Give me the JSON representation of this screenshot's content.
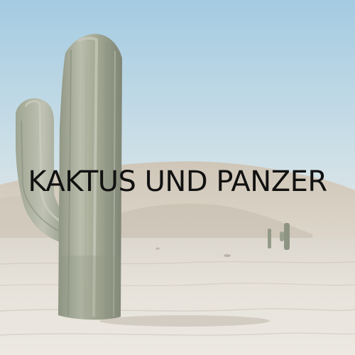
{
  "title": "KAKTUS UND PANZER",
  "colors": {
    "sky_top": "#a9cde3",
    "sky_bottom": "#d9e6ea",
    "dune": "#d6cfc3",
    "dune_shadow": "#b9b0a2",
    "ground": "#e9e5dd",
    "ground_far": "#dcd7ce",
    "cactus_light": "#b8bcab",
    "cactus_mid": "#9aa08e",
    "cactus_dark": "#7d8372",
    "title_text": "#111111"
  },
  "icons": [
    "cactus-icon",
    "distant-cactus-icon"
  ]
}
